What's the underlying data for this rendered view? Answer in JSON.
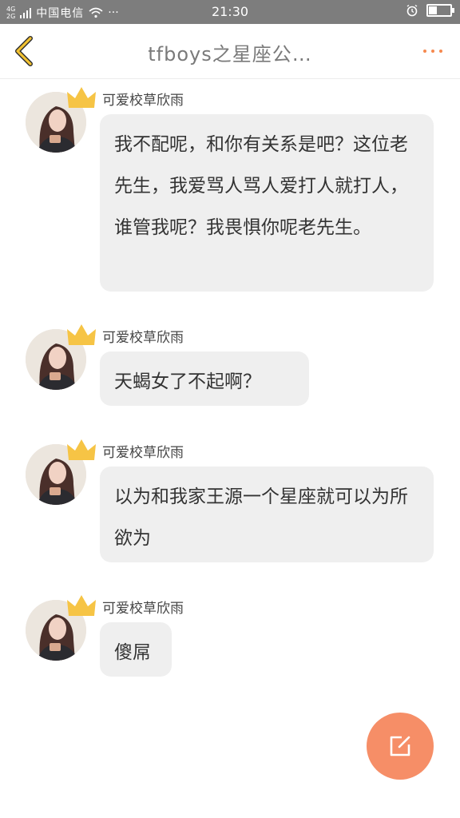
{
  "status_bar": {
    "net_top": "4G",
    "net_bottom": "2G",
    "carrier": "中国电信",
    "more": "···",
    "time": "21:30",
    "battery_level": 0.4
  },
  "header": {
    "title": "tfboys之星座公…"
  },
  "messages": [
    {
      "username": "可爱校草欣雨",
      "text": "我不配呢，和你有关系是吧？这位老先生，我爱骂人骂人爱打人就打人，谁管我呢？我畏惧你呢老先生。"
    },
    {
      "username": "可爱校草欣雨",
      "text": "天蝎女了不起啊？"
    },
    {
      "username": "可爱校草欣雨",
      "text": "以为和我家王源一个星座就可以为所欲为"
    },
    {
      "username": "可爱校草欣雨",
      "text": "傻屌"
    }
  ],
  "colors": {
    "accent": "#f6894f",
    "fab": "#f68e67",
    "bubble": "#efefef",
    "crown": "#f6c445"
  },
  "icons": {
    "back": "chevron-left-icon",
    "more": "more-dots-icon",
    "compose": "edit-icon",
    "crown": "crown-icon"
  }
}
